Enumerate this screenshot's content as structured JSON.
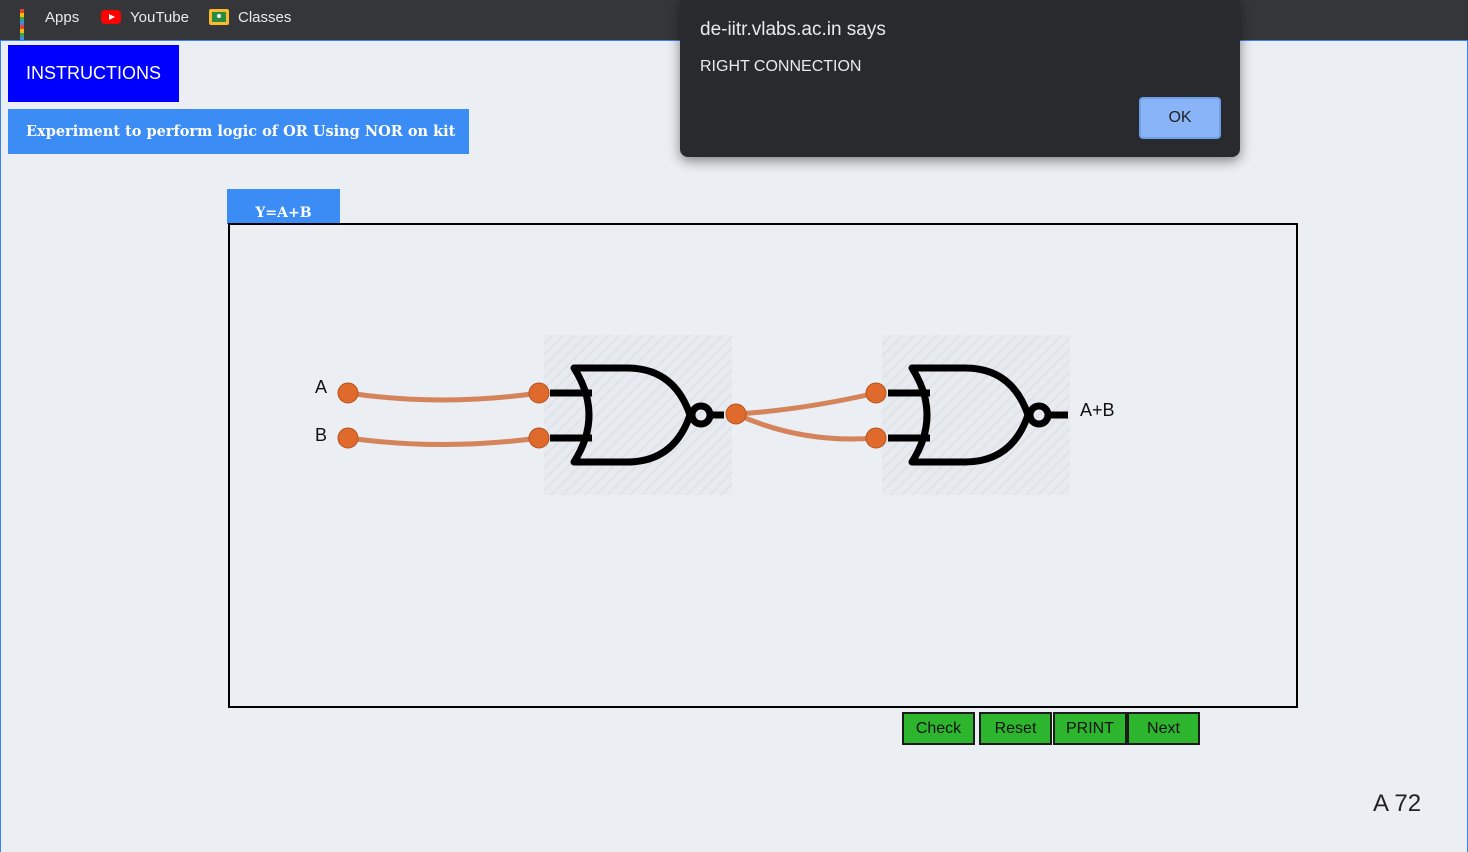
{
  "bookmarks": {
    "items": [
      {
        "label": "Apps",
        "icon": "apps-grid-icon"
      },
      {
        "label": "YouTube",
        "icon": "youtube-icon"
      },
      {
        "label": "Classes",
        "icon": "classes-icon"
      }
    ]
  },
  "page": {
    "instructions_label": "INSTRUCTIONS",
    "experiment_title": "Experiment to perform logic of OR Using NOR on kit",
    "equation_tab": "Y=A+B",
    "inputs": {
      "a": "A",
      "b": "B"
    },
    "output": "A+B",
    "controls": {
      "check": "Check",
      "reset": "Reset",
      "print": "PRINT",
      "next": "Next"
    },
    "footer_code": "A 72"
  },
  "dialog": {
    "title": "de-iitr.vlabs.ac.in says",
    "message": "RIGHT CONNECTION",
    "ok_label": "OK"
  },
  "colors": {
    "instructions_bg": "#0000ff",
    "tab_bg": "#3b8cf5",
    "control_bg": "#2db52d",
    "wire": "#d4835a",
    "node": "#e06a2c",
    "dialog_bg": "#292a2d",
    "ok_bg": "#8ab4f8"
  }
}
